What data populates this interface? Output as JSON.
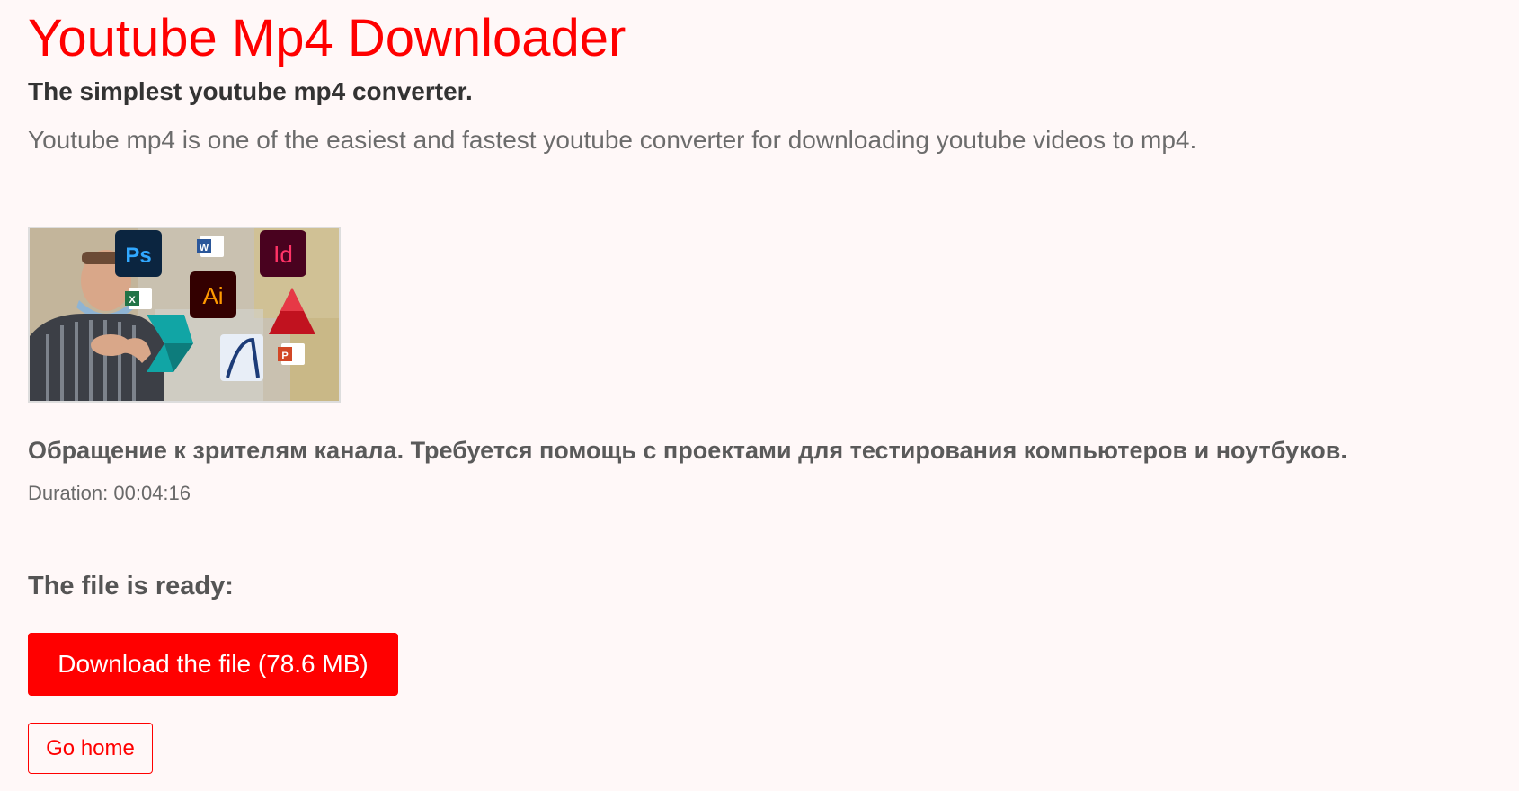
{
  "header": {
    "title": "Youtube Mp4 Downloader",
    "subtitle": "The simplest youtube mp4 converter.",
    "lead": "Youtube mp4 is one of the easiest and fastest youtube converter for downloading youtube videos to mp4."
  },
  "video": {
    "title": "Обращение к зрителям канала. Требуется помощь с проектами для тестирования компьютеров и ноутбуков.",
    "duration": "Duration: 00:04:16",
    "thumbnail_icons": {
      "ps": "Ps",
      "ai": "Ai",
      "id": "Id",
      "word": "W",
      "excel": "X",
      "powerpoint": "P"
    }
  },
  "result": {
    "ready_label": "The file is ready:",
    "download_label": "Download the file (78.6 MB)",
    "home_label": "Go home"
  },
  "colors": {
    "accent": "#ff0000",
    "background": "#fff8f8"
  }
}
